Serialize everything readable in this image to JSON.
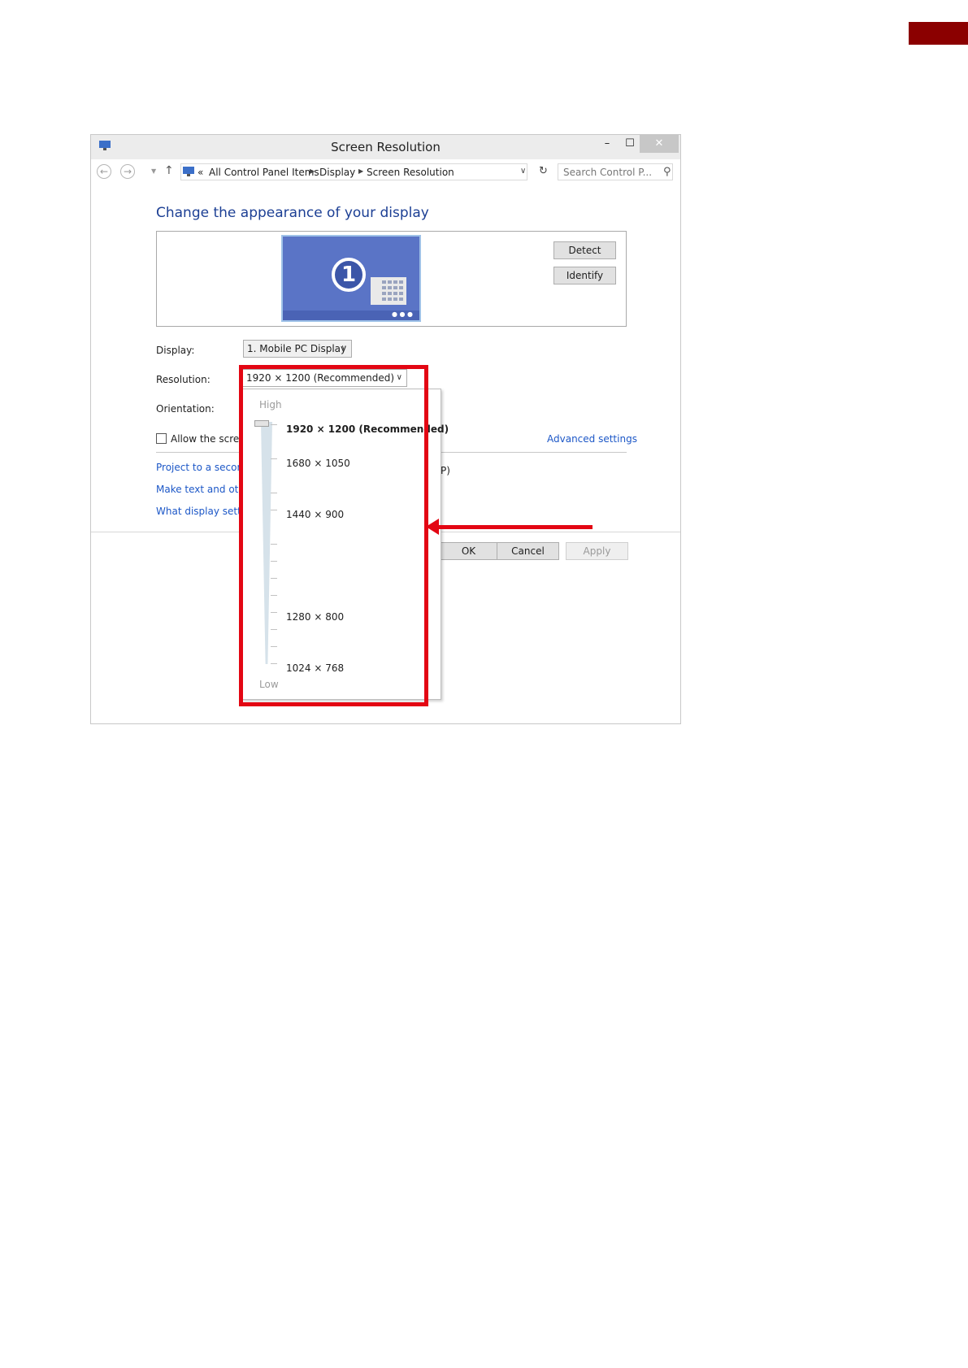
{
  "colors": {
    "accent_red": "#e30613",
    "corner_tab": "#8b0000",
    "link": "#1c57c7",
    "heading": "#1c3f94"
  },
  "window": {
    "title": "Screen Resolution",
    "minimize_label": "–",
    "maximize_label": "☐",
    "close_label": "✕"
  },
  "nav": {
    "back_icon": "back-arrow-icon",
    "forward_icon": "forward-arrow-icon",
    "breadcrumb": [
      "«",
      "All Control Panel Items",
      "Display",
      "Screen Resolution"
    ],
    "search_placeholder": "Search Control P..."
  },
  "main": {
    "heading": "Change the appearance of your display",
    "monitor_number": "1",
    "detect_label": "Detect",
    "identify_label": "Identify",
    "display_label": "Display:",
    "display_value": "1. Mobile PC Display",
    "resolution_label": "Resolution:",
    "resolution_value": "1920 × 1200 (Recommended)",
    "orientation_label": "Orientation:",
    "allow_label": "Allow the scree",
    "advanced_link": "Advanced settings",
    "links": [
      "Project to a secon",
      "Make text and oth",
      "What display settir"
    ],
    "tail_text": "P)"
  },
  "buttons": {
    "ok": "OK",
    "cancel": "Cancel",
    "apply": "Apply"
  },
  "resolution_dropdown": {
    "high_label": "High",
    "low_label": "Low",
    "options": [
      "1920 × 1200 (Recommended)",
      "1680 × 1050",
      "1440 × 900",
      "1280 × 800",
      "1024 × 768"
    ],
    "selected_index": 0
  }
}
